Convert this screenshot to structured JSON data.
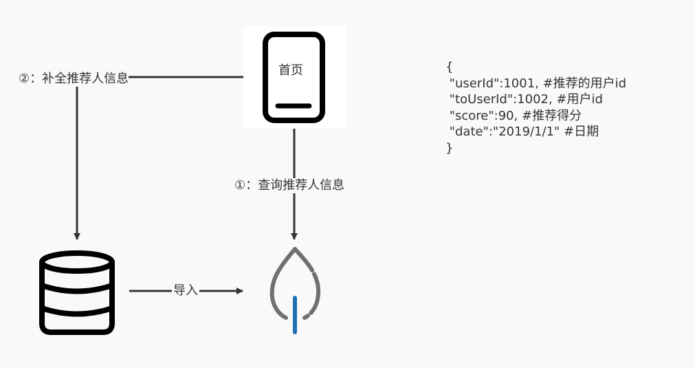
{
  "nodes": {
    "phone": {
      "label": "首页",
      "icon": "mobile-phone-icon"
    },
    "database": {
      "icon": "database-icon"
    },
    "mongodb": {
      "icon": "mongodb-leaf-icon"
    }
  },
  "edges": {
    "query": {
      "label": "①：查询推荐人信息"
    },
    "fill": {
      "label": "②：补全推荐人信息"
    },
    "import": {
      "label": "导入"
    }
  },
  "json_example": {
    "lines": [
      "{",
      " \"userId\":1001, #推荐的用户id",
      " \"toUserId\":1002, #用户id",
      " \"score\":90, #推荐得分",
      " \"date\":\"2019/1/1\" #日期",
      "}"
    ]
  },
  "colors": {
    "background": "#f9f9f9",
    "stroke": "#333333",
    "icon_black": "#000000",
    "leaf_gray": "#707070",
    "leaf_blue": "#1f6fb5"
  }
}
